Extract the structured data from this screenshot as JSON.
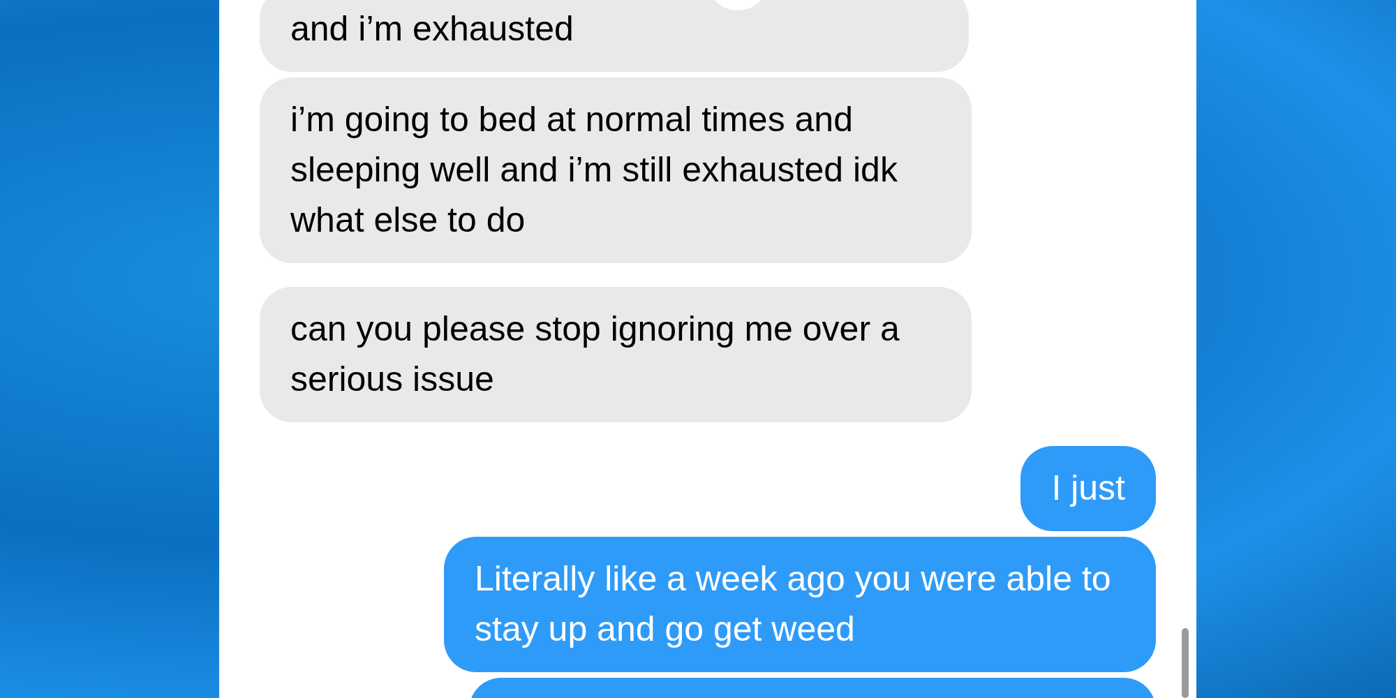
{
  "messages": [
    {
      "kind": "received",
      "text": "and i’m exhausted",
      "reaction": true
    },
    {
      "kind": "received",
      "text": "i’m going to bed at normal times and sleeping well and i’m still exhausted idk what else to do"
    },
    {
      "kind": "received",
      "text": "can you please stop ignoring me over a serious issue"
    },
    {
      "kind": "sent",
      "text": "I just"
    },
    {
      "kind": "sent",
      "text": "Literally like a week ago you were able to stay up and go get weed"
    },
    {
      "kind": "sent"
    }
  ]
}
